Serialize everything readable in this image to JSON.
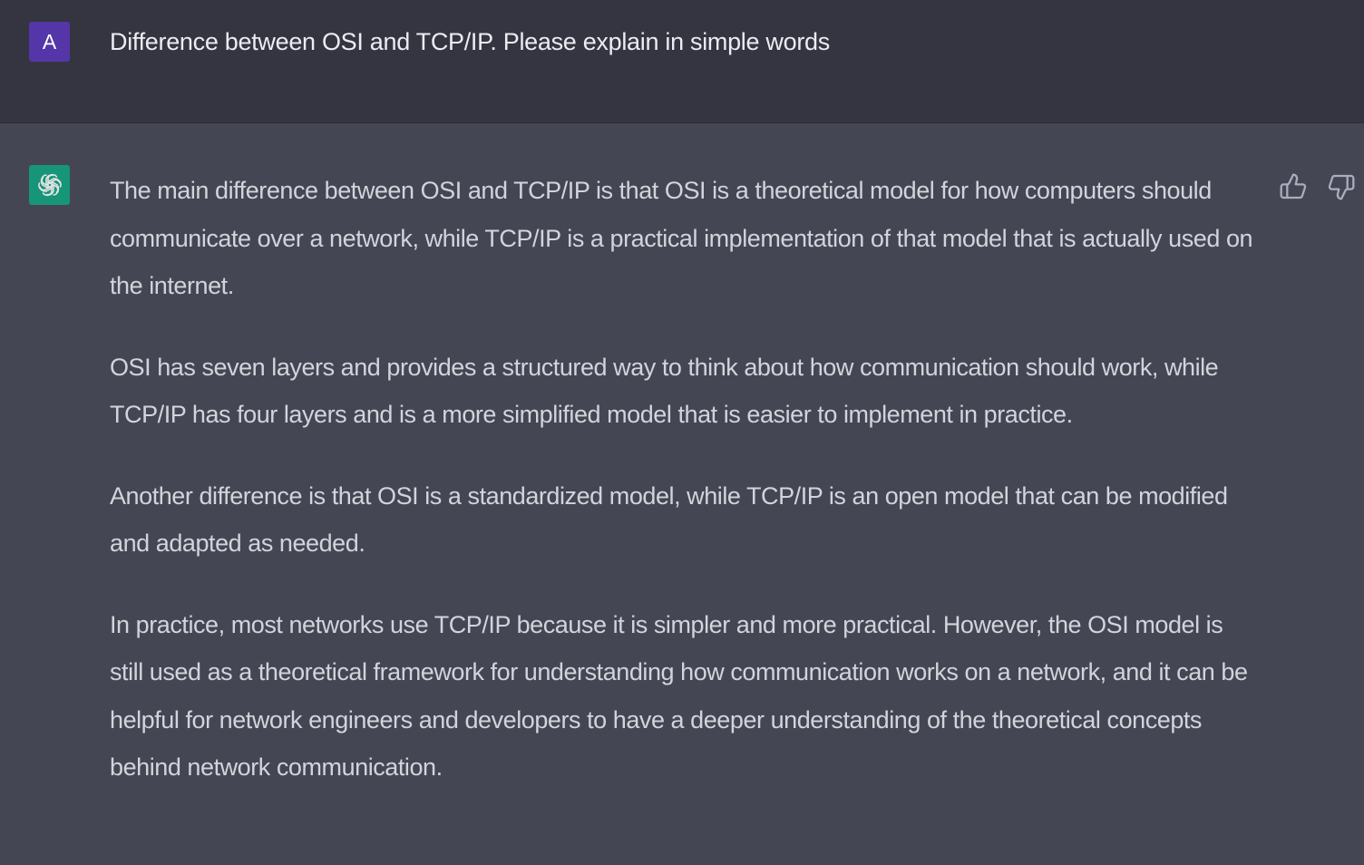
{
  "user": {
    "avatar_letter": "A",
    "message": "Difference between OSI and TCP/IP. Please explain in simple words"
  },
  "assistant": {
    "avatar_icon": "openai-logo-icon",
    "paragraphs": [
      "The main difference between OSI and TCP/IP is that OSI is a theoretical model for how computers should communicate over a network, while TCP/IP is a practical implementation of that model that is actually used on the internet.",
      "OSI has seven layers and provides a structured way to think about how communication should work, while TCP/IP has four layers and is a more simplified model that is easier to implement in practice.",
      "Another difference is that OSI is a standardized model, while TCP/IP is an open model that can be modified and adapted as needed.",
      "In practice, most networks use TCP/IP because it is simpler and more practical. However, the OSI model is still used as a theoretical framework for understanding how communication works on a network, and it can be helpful for network engineers and developers to have a deeper understanding of the theoretical concepts behind network communication."
    ],
    "feedback_icons": [
      "thumbs-up-icon",
      "thumbs-down-icon"
    ]
  },
  "colors": {
    "user_background": "#343541",
    "assistant_background": "#444654",
    "user_avatar": "#5436a8",
    "assistant_avatar": "#10a37f",
    "text": "#d1d5db"
  }
}
